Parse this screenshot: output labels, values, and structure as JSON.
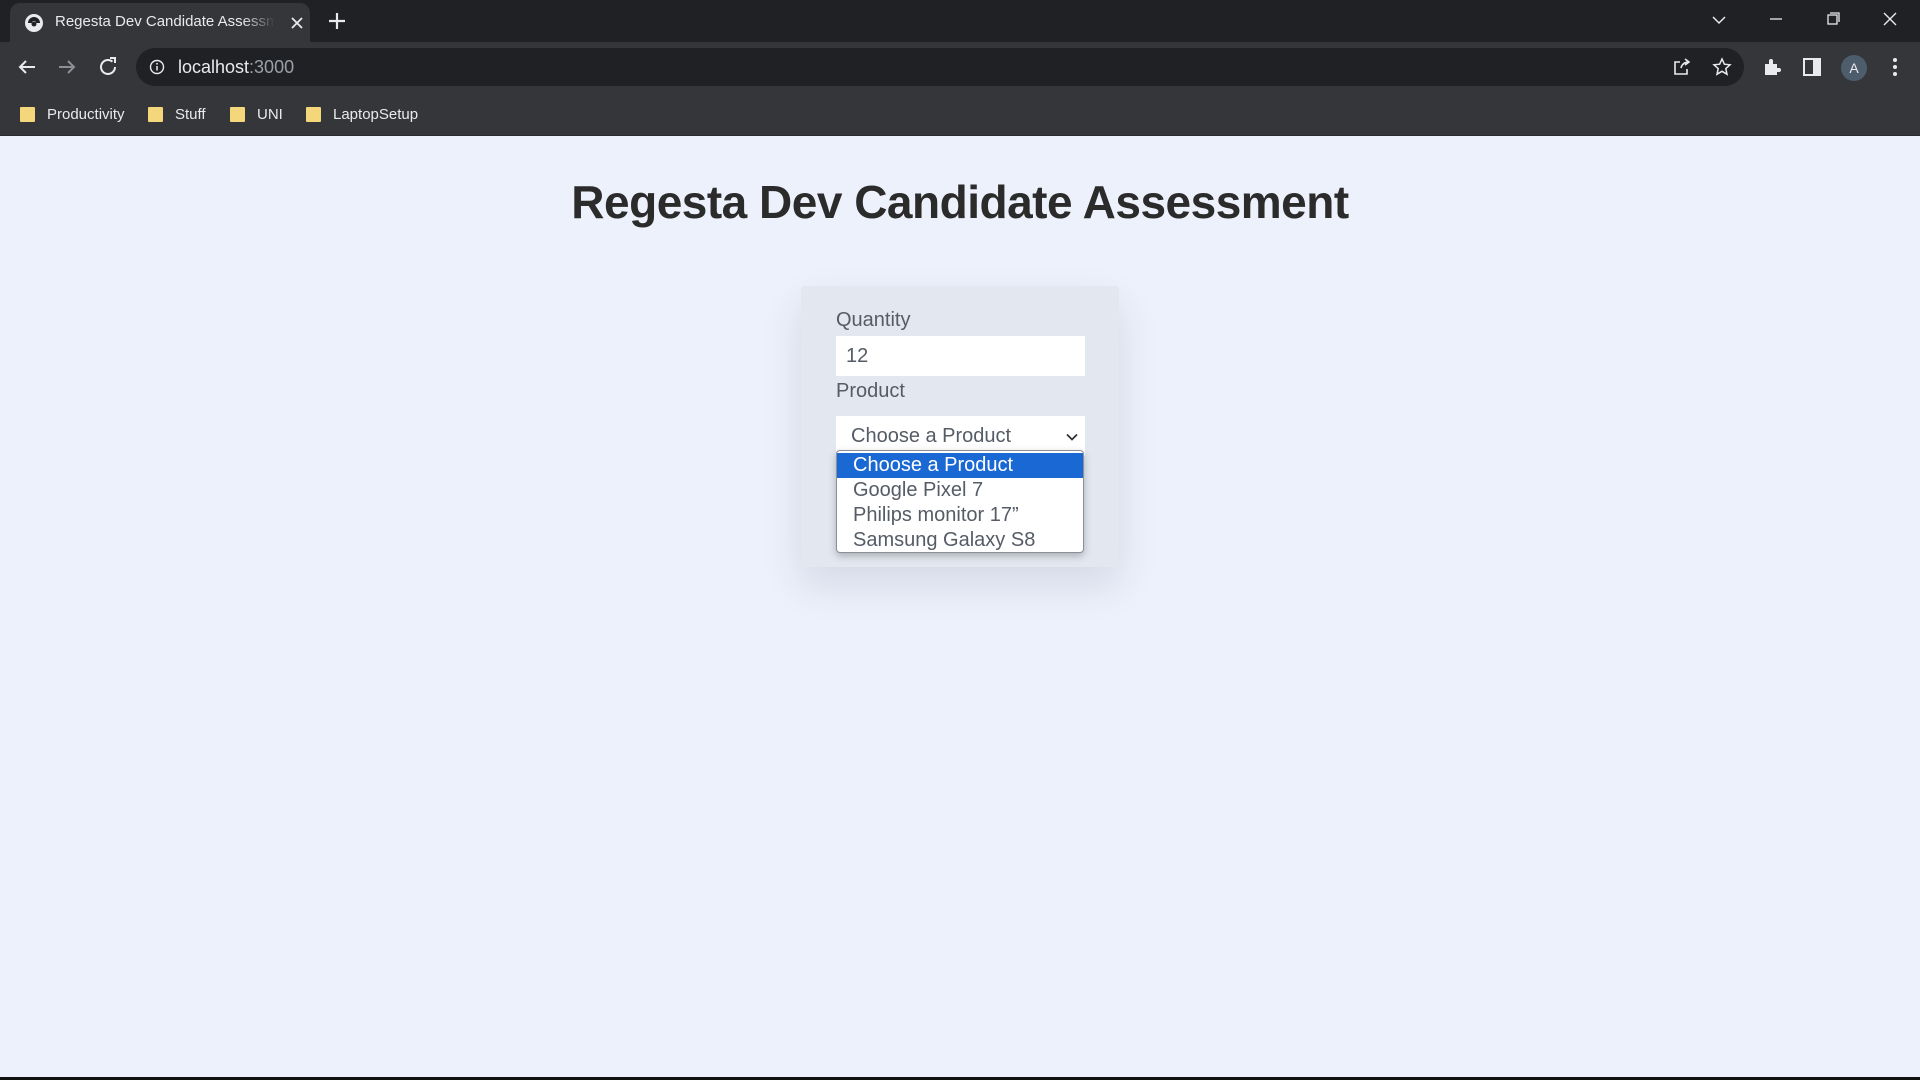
{
  "browser": {
    "tab_title": "Regesta Dev Candidate Assessment",
    "url_host": "localhost",
    "url_port": ":3000",
    "avatar_letter": "A",
    "bookmarks": [
      {
        "label": "Productivity"
      },
      {
        "label": "Stuff"
      },
      {
        "label": "UNI"
      },
      {
        "label": "LaptopSetup"
      }
    ]
  },
  "page": {
    "title": "Regesta Dev Candidate Assessment"
  },
  "form": {
    "quantity_label": "Quantity",
    "quantity_value": "12",
    "product_label": "Product",
    "product_selected": "Choose a Product",
    "options": [
      {
        "label": "Choose a Product",
        "highlighted": true
      },
      {
        "label": "Google Pixel 7",
        "highlighted": false
      },
      {
        "label": "Philips monitor 17”",
        "highlighted": false
      },
      {
        "label": "Samsung Galaxy S8",
        "highlighted": false
      }
    ]
  },
  "colors": {
    "page_bg": "#edf1fb",
    "card_bg": "#e3e7f0",
    "highlight": "#1a68d4",
    "chrome_dark": "#202124",
    "chrome_toolbar": "#35363a",
    "folder_yellow": "#f4d67b"
  },
  "icons": {
    "favicon": "browser-favicon",
    "bookmark_folder": "folder-icon"
  }
}
